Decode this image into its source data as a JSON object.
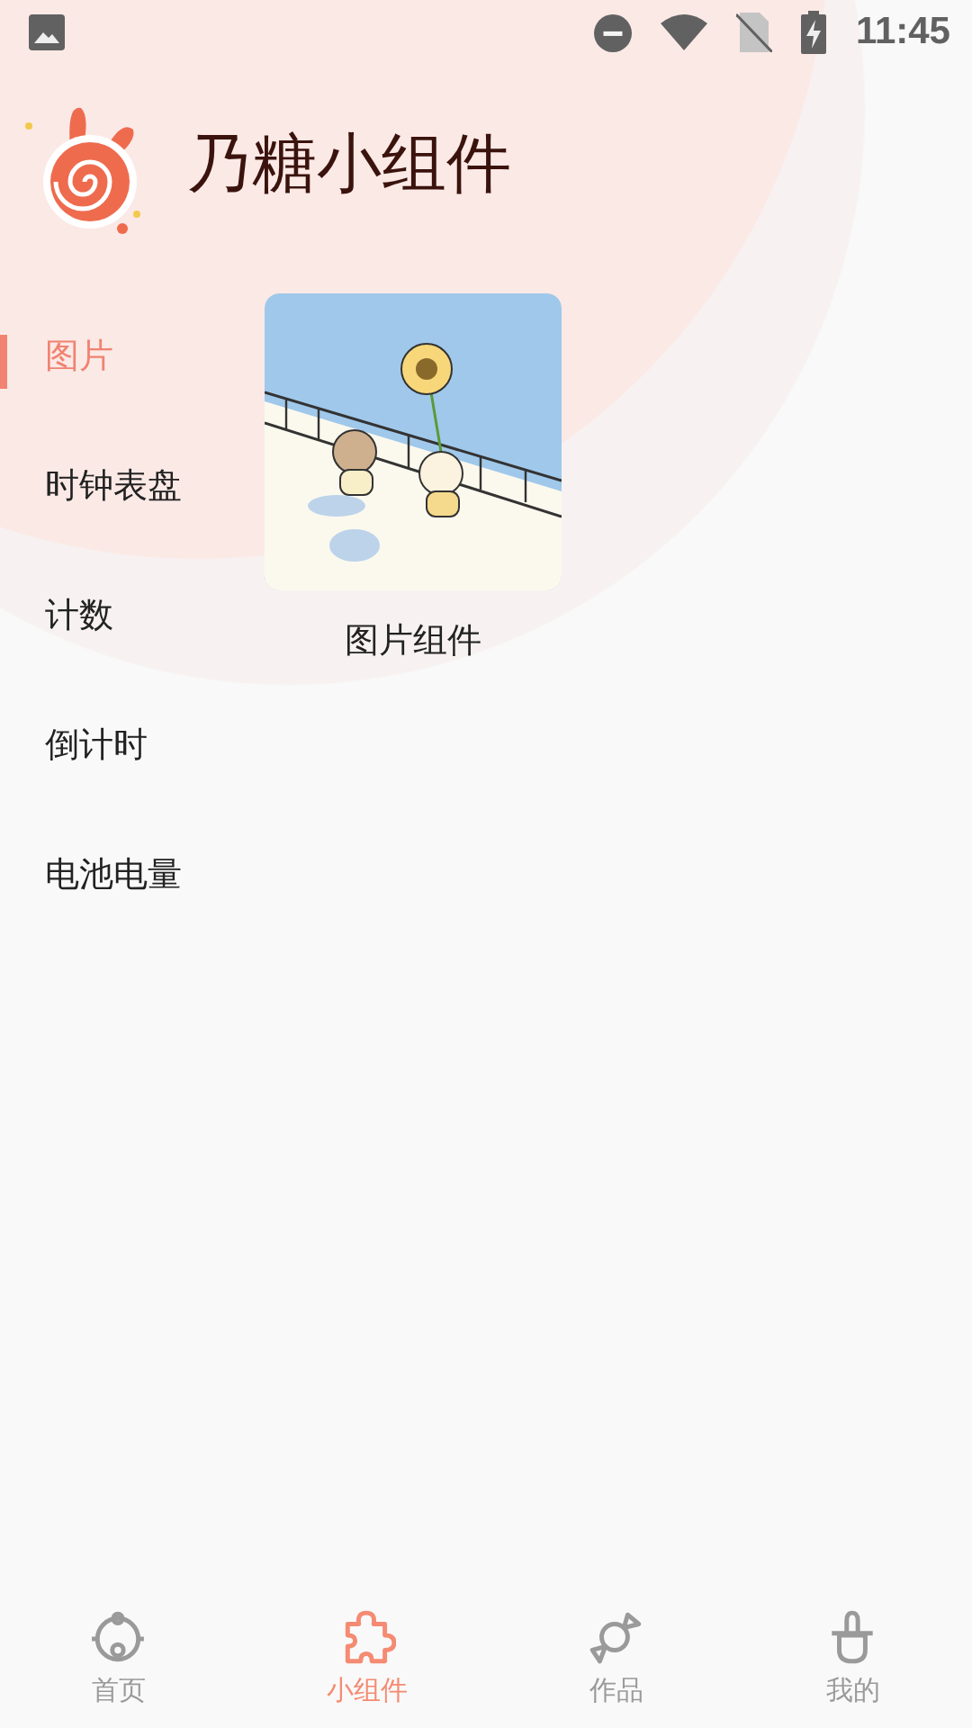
{
  "status_bar": {
    "time": "11:45"
  },
  "header": {
    "title": "乃糖小组件"
  },
  "sidebar": {
    "items": [
      {
        "label": "图片",
        "selected": true
      },
      {
        "label": "时钟表盘",
        "selected": false
      },
      {
        "label": "计数",
        "selected": false
      },
      {
        "label": "倒计时",
        "selected": false
      },
      {
        "label": "电池电量",
        "selected": false
      }
    ]
  },
  "widgets": [
    {
      "label": "图片组件"
    }
  ],
  "bottom_nav": [
    {
      "label": "首页",
      "selected": false
    },
    {
      "label": "小组件",
      "selected": true
    },
    {
      "label": "作品",
      "selected": false
    },
    {
      "label": "我的",
      "selected": false
    }
  ]
}
